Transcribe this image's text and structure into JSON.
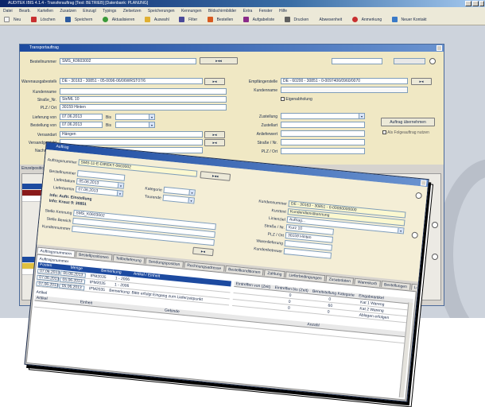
{
  "app": {
    "title": "AUDITEK IBIS 4.1.4 - Transferauftrag [Test: BETRIEB] [Datenbank: PLANUNG]",
    "menu": [
      "Datei",
      "Bearb.",
      "Kartellen",
      "Zusatzen",
      "Einzugl",
      "Typings",
      "Zielsetzen",
      "Speicherungen",
      "Kennungen",
      "Bildschirmbilder",
      "Extra",
      "Fenster",
      "Hilfe"
    ],
    "toolbar": [
      "Neu",
      "Löschen",
      "Speichern",
      "Aktualisieren",
      "Auswahl",
      "Filter",
      "Bestellen",
      "Aufgabeliste",
      "Drucken",
      "Abwesenheit",
      "Anmerkung",
      "Neuer Kontakt"
    ]
  },
  "dialog_back": {
    "title": "Transportauftrag",
    "order_label": "Bestellnummer",
    "order_value": "SMS_K0603002",
    "fields_left": [
      {
        "label": "Warenausgabestelle",
        "value": "DE - 30163 - 30851 - 05-0096-06/06WRST07/6"
      },
      {
        "label": "Kundenname",
        "value": ""
      },
      {
        "label": "Straße_Nr.",
        "value": "Str/ML 10"
      },
      {
        "label": "PLZ / Ort",
        "value": "30159 Hinten"
      },
      {
        "label": "Lieferung von",
        "value": "07.06.2013"
      },
      {
        "label": "Bestellung von",
        "value": "07.06.2013"
      },
      {
        "label": "Versandart",
        "value": "Hängen"
      },
      {
        "label": "Versandgewicht",
        "value": ""
      },
      {
        "label": "Nachnahme",
        "value": ""
      }
    ],
    "fields_right": [
      {
        "label": "Empfängerstelle",
        "value": "DE - 60200 - 30851 - 0-0097406/0960/0070"
      },
      {
        "label": "Kundenname",
        "value": ""
      },
      {
        "label": "Zustellung",
        "value": ""
      },
      {
        "label": "Zustellart",
        "value": ""
      },
      {
        "label": "Anlieferwert",
        "value": ""
      },
      {
        "label": "Straße / Nr.",
        "value": ""
      },
      {
        "label": "PLZ / Ort",
        "value": ""
      }
    ],
    "bis_label": "Bis",
    "ext_label": "Eigenabholung",
    "button_label": "Auftrag übernehmen",
    "checkbox_label": "Als Folgeauftrag nutzen",
    "grid_label": "Einzelposition / Details"
  },
  "dialog_front": {
    "title": "Auftrag",
    "top_label": "Auftragsnummer",
    "top_value": "SMS-11-E-DIREKT-0603002",
    "rows_left": [
      {
        "label": "Bestellnummer",
        "value": ""
      },
      {
        "label": "Lieferdatum",
        "value": "05.06.2013"
      },
      {
        "label": "Liefertermin",
        "value": "07.06.2013"
      }
    ],
    "info1": "Info: Auftr. Einstellung",
    "info2": "Info: Kreuz 9: 30851",
    "right_labels": [
      "Kategorie",
      "Tourende"
    ],
    "fields_left": [
      {
        "label": "Stelle Kennung",
        "value": "SMS_K0603002"
      },
      {
        "label": "Stelle Bereich",
        "value": ""
      },
      {
        "label": "Kundennummer",
        "value": ""
      }
    ],
    "fields_right": [
      {
        "label": "Kundennummer",
        "value": "DE - 30163 - 30851 - 0-00090000000"
      },
      {
        "label": "Kurztext",
        "value": "Kundendienstkennung"
      },
      {
        "label": "Linienziel",
        "value": "Auftrag..."
      },
      {
        "label": "Straße / Nr.",
        "value": "Kurz 10"
      },
      {
        "label": "PLZ / Ort",
        "value": "30159 Hinten"
      },
      {
        "label": "Warenlieferung",
        "value": ""
      },
      {
        "label": "Kundenbetreuer",
        "value": ""
      }
    ],
    "tabs": [
      "Auftragsnummern",
      "Bestellpositionen",
      "Teilbelieferung",
      "Sendungsposition",
      "Rechnungsadresse",
      "Bestellkonditionen",
      "Zahlung",
      "Lieferbedingungen",
      "Zusatzdaten",
      "Warenkorb",
      "Bestellungen",
      "Leistungen"
    ],
    "section1": "Auftragsnummer",
    "headers1": [
      "Posten",
      "Menge",
      "Bemerkung",
      "Artikel / Einheit"
    ],
    "rows1": [
      [
        "07.06.2013",
        "05.06.2013",
        "IPM2035",
        "1 - 2006"
      ],
      [
        "07.06.2013",
        "05.06.2013",
        "IPM2035",
        "1 - 2006"
      ],
      [
        "07.06.2013",
        "05.06.2013",
        "IPM2035",
        "Bemerkung: Bitte erfolgt Eingang zum Lieferzeitpunkt"
      ]
    ],
    "cols_right": [
      "Eintreffen von (Zeit)",
      "Eintreffen bis (Zeit)",
      "Bereitstellung Kategorie",
      "Eingabeartikel"
    ],
    "rows_right": [
      [
        "0",
        "0",
        "Kat 1 Wareng"
      ],
      [
        "0",
        "60",
        "Kat 2 Wareng"
      ],
      [
        "0",
        "0",
        "Ablagen erfolgen"
      ]
    ],
    "section2": "Artikel",
    "headers2": [
      "Artikel",
      "Einheit",
      "Gebinde",
      "Anzahl"
    ]
  }
}
